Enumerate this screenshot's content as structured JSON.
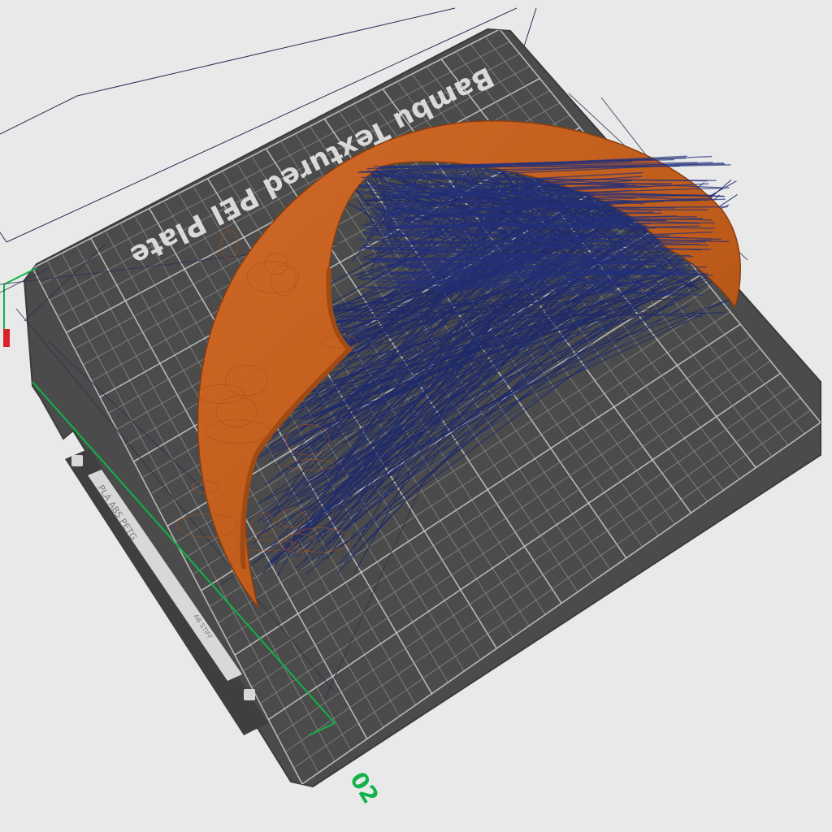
{
  "viewport": {
    "plate_name": "Bambu Textured PEI Plate",
    "plate_number": "02",
    "filament_label": "PLA ABS PETG",
    "hint_label": "AB STIFF"
  },
  "colors": {
    "background": "#e9e9ea",
    "plate": "#4a4b4a",
    "plate_edge": "#3a3b3a",
    "grid_minor": "#8a8b8a",
    "grid_major": "#c9caca",
    "model_orange": "#c8631f",
    "model_orange_dark": "#9b4612",
    "travel_blue": "#1f2a6b",
    "accent_green": "#10b34a"
  }
}
